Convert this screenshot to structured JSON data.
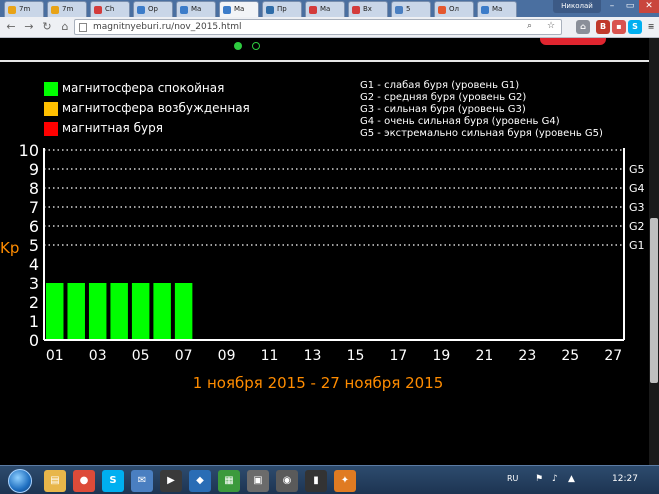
{
  "browser": {
    "tabs": [
      {
        "label": "7m",
        "favicon_color": "#e8a317"
      },
      {
        "label": "7m",
        "favicon_color": "#e8a317"
      },
      {
        "label": "Ch",
        "favicon_color": "#d33b3b"
      },
      {
        "label": "Op",
        "favicon_color": "#3c7cc9"
      },
      {
        "label": "Ma",
        "favicon_color": "#3c7cc9"
      },
      {
        "label": "Ma",
        "favicon_color": "#3c7cc9",
        "active": true
      },
      {
        "label": "Пр",
        "favicon_color": "#2e6ca8"
      },
      {
        "label": "Ma",
        "favicon_color": "#d33b3b"
      },
      {
        "label": "Вх",
        "favicon_color": "#d33b3b"
      },
      {
        "label": "5",
        "favicon_color": "#4a7fc1"
      },
      {
        "label": "Ол",
        "favicon_color": "#e4572e"
      },
      {
        "label": "Ma",
        "favicon_color": "#3c7cc9"
      }
    ],
    "user": "Николай",
    "url": "magnitnyeburi.ru/nov_2015.html"
  },
  "legend": [
    {
      "label": "магнитосфера спокойная",
      "color": "#00ff00"
    },
    {
      "label": "магнитосфера возбужденная",
      "color": "#ffc000"
    },
    {
      "label": "магнитная буря",
      "color": "#ff0000"
    }
  ],
  "storm_levels": [
    "G1 - слабая буря (уровень G1)",
    "G2 - средняя буря (уровень G2)",
    "G3 - сильная буря (уровень G3)",
    "G4 - очень сильная буря (уровень G4)",
    "G5 - экстремально сильная буря (уровень G5)"
  ],
  "chart_data": {
    "type": "bar",
    "ylabel": "Kp",
    "xlabel": "1 ноября 2015 - 27 ноября 2015",
    "ylim": [
      0,
      10
    ],
    "yticks": [
      "0",
      "1",
      "2",
      "3",
      "4",
      "5",
      "6",
      "7",
      "8",
      "9",
      "10"
    ],
    "g_labels": [
      {
        "label": "G1",
        "kp": 5
      },
      {
        "label": "G2",
        "kp": 6
      },
      {
        "label": "G3",
        "kp": 7
      },
      {
        "label": "G4",
        "kp": 8
      },
      {
        "label": "G5",
        "kp": 9
      }
    ],
    "gridlines_kp": [
      5,
      6,
      7,
      8,
      9,
      10
    ],
    "grid": "dotted",
    "xticks": [
      "01",
      "03",
      "05",
      "07",
      "09",
      "11",
      "13",
      "15",
      "17",
      "19",
      "21",
      "23",
      "25",
      "27"
    ],
    "days_total": 27,
    "bar_color": "#00ff00",
    "axis_label_color": "#ff8c00",
    "bars": [
      {
        "day": 1,
        "kp": 3
      },
      {
        "day": 2,
        "kp": 3
      },
      {
        "day": 3,
        "kp": 3
      },
      {
        "day": 4,
        "kp": 3
      },
      {
        "day": 5,
        "kp": 3
      },
      {
        "day": 6,
        "kp": 3
      },
      {
        "day": 7,
        "kp": 3
      }
    ]
  },
  "taskbar": {
    "apps": [
      {
        "name": "explorer",
        "color": "#e8b64a",
        "glyph": "▤"
      },
      {
        "name": "chrome",
        "color": "#dd4b39",
        "glyph": "●"
      },
      {
        "name": "skype",
        "color": "#00aff0",
        "glyph": "S"
      },
      {
        "name": "mail",
        "color": "#4a7fc1",
        "glyph": "✉"
      },
      {
        "name": "media",
        "color": "#3a3a3a",
        "glyph": "▶"
      },
      {
        "name": "app-blue",
        "color": "#2a6db5",
        "glyph": "◆"
      },
      {
        "name": "app-green",
        "color": "#3c9a3c",
        "glyph": "▦"
      },
      {
        "name": "app-grey",
        "color": "#6b6b6b",
        "glyph": "▣"
      },
      {
        "name": "app-media",
        "color": "#5a5a5a",
        "glyph": "◉"
      },
      {
        "name": "app-terminal",
        "color": "#333",
        "glyph": "▮"
      },
      {
        "name": "app-orange",
        "color": "#e07b22",
        "glyph": "✦"
      }
    ],
    "lang": "RU",
    "time": "12:27"
  }
}
